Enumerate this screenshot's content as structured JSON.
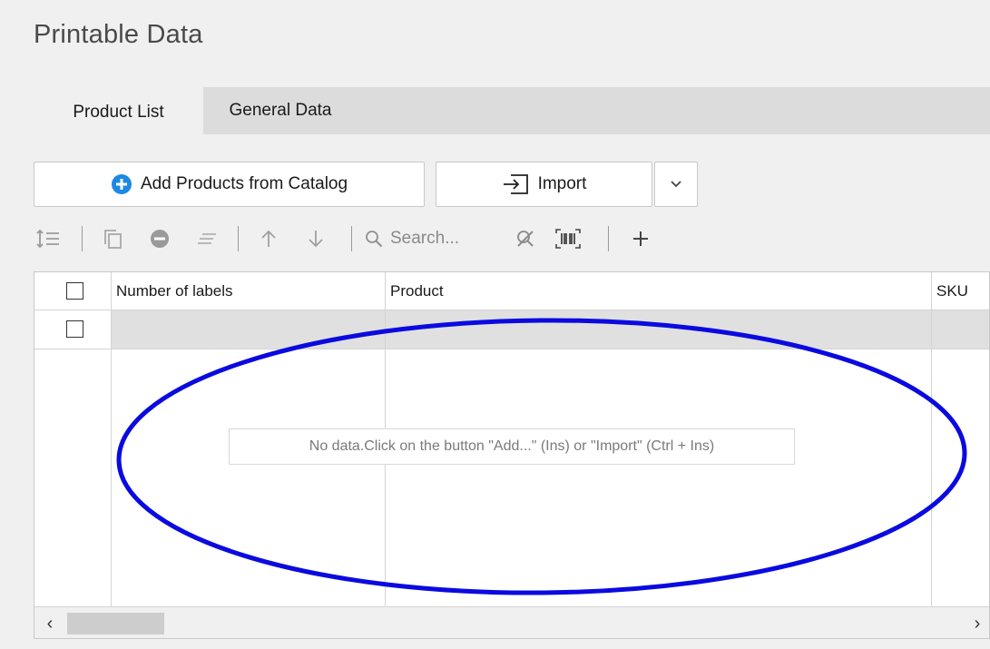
{
  "page": {
    "title": "Printable Data"
  },
  "tabs": [
    {
      "label": "Product List",
      "active": true
    },
    {
      "label": "General Data",
      "active": false
    }
  ],
  "buttons": {
    "add_label": "Add Products from Catalog",
    "import_label": "Import"
  },
  "toolbar": {
    "search_placeholder": "Search...",
    "icons": [
      "row-height-icon",
      "copy-icon",
      "remove-icon",
      "align-icon",
      "arrow-up-icon",
      "arrow-down-icon",
      "search-icon",
      "clear-filter-icon",
      "barcode-icon",
      "plus-icon"
    ]
  },
  "grid": {
    "columns": [
      "Number of labels",
      "Product",
      "SKU"
    ],
    "empty_message": "No data.Click on the button \"Add...\" (Ins) or \"Import\" (Ctrl + Ins)"
  },
  "colors": {
    "accent": "#1e88e5",
    "annotation": "#0a0ae0"
  }
}
